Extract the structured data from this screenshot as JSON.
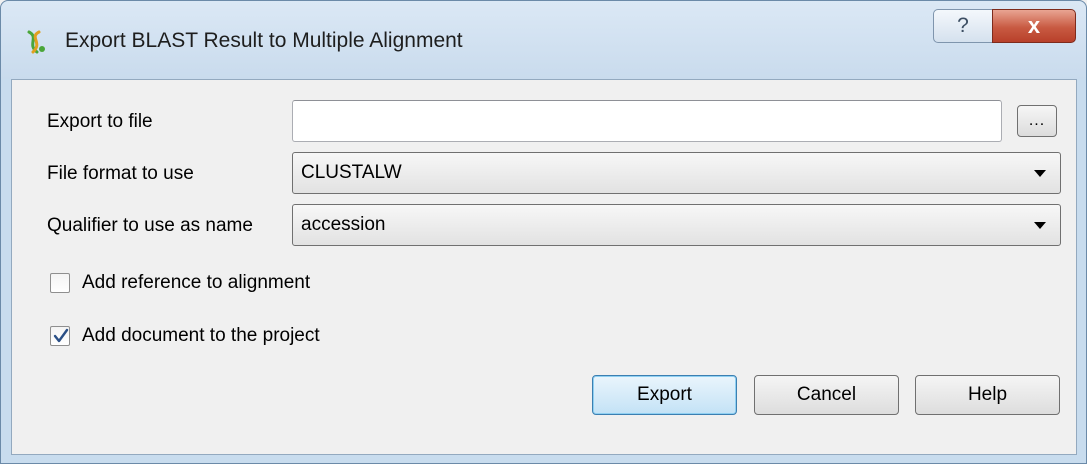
{
  "window": {
    "title": "Export BLAST Result to Multiple Alignment",
    "help_glyph": "?",
    "close_glyph": "x"
  },
  "form": {
    "export_to_file": {
      "label": "Export to file",
      "value": "",
      "browse_label": "..."
    },
    "file_format": {
      "label": "File format to use",
      "selected": "CLUSTALW"
    },
    "qualifier": {
      "label": "Qualifier to use as name",
      "selected": "accession"
    },
    "add_reference": {
      "label": "Add reference to alignment",
      "checked": false
    },
    "add_document": {
      "label": "Add document to the project",
      "checked": true
    }
  },
  "buttons": {
    "export": "Export",
    "cancel": "Cancel",
    "help": "Help"
  },
  "icons": {
    "app": "dna-helix-icon",
    "dropdown": "chevron-down-icon",
    "check": "checkmark-icon"
  },
  "colors": {
    "default_button_border": "#3c7fb1",
    "close_button": "#c85a42",
    "checkmark": "#2a4f86"
  }
}
